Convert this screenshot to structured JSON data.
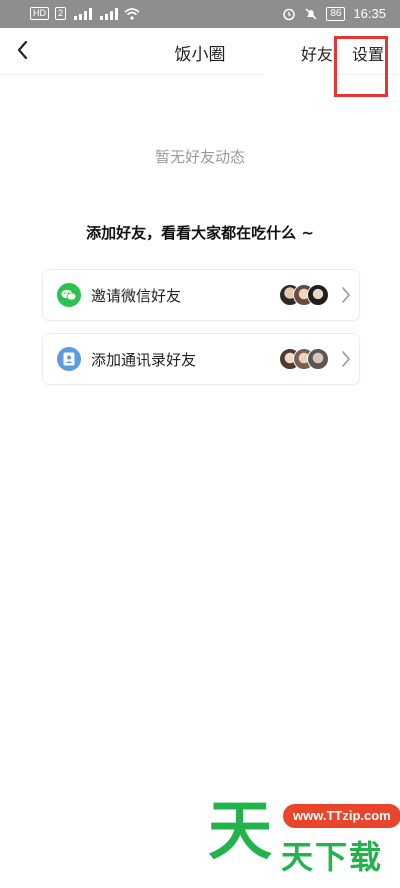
{
  "status_bar": {
    "left_badges": [
      "HD",
      "2"
    ],
    "signal_labels": [
      "4G",
      "4G"
    ],
    "battery": "86",
    "time": "16:35"
  },
  "nav": {
    "title": "饭小圈",
    "friends_label": "好友",
    "settings_label": "设置"
  },
  "main": {
    "empty_text": "暂无好友动态",
    "prompt": "添加好友，看看大家都在吃什么 ~",
    "cards": [
      {
        "label": "邀请微信好友",
        "icon": "wechat-icon"
      },
      {
        "label": "添加通讯录好友",
        "icon": "contacts-icon"
      }
    ]
  },
  "watermark": {
    "logo_char": "天",
    "url": "www.TTzip.com",
    "text": "天下载"
  },
  "colors": {
    "wechat_green": "#2dc24e",
    "contacts_blue": "#5b9be0",
    "highlight_red": "#e53434",
    "watermark_green": "#22b34b",
    "watermark_orange": "#e8452c"
  }
}
